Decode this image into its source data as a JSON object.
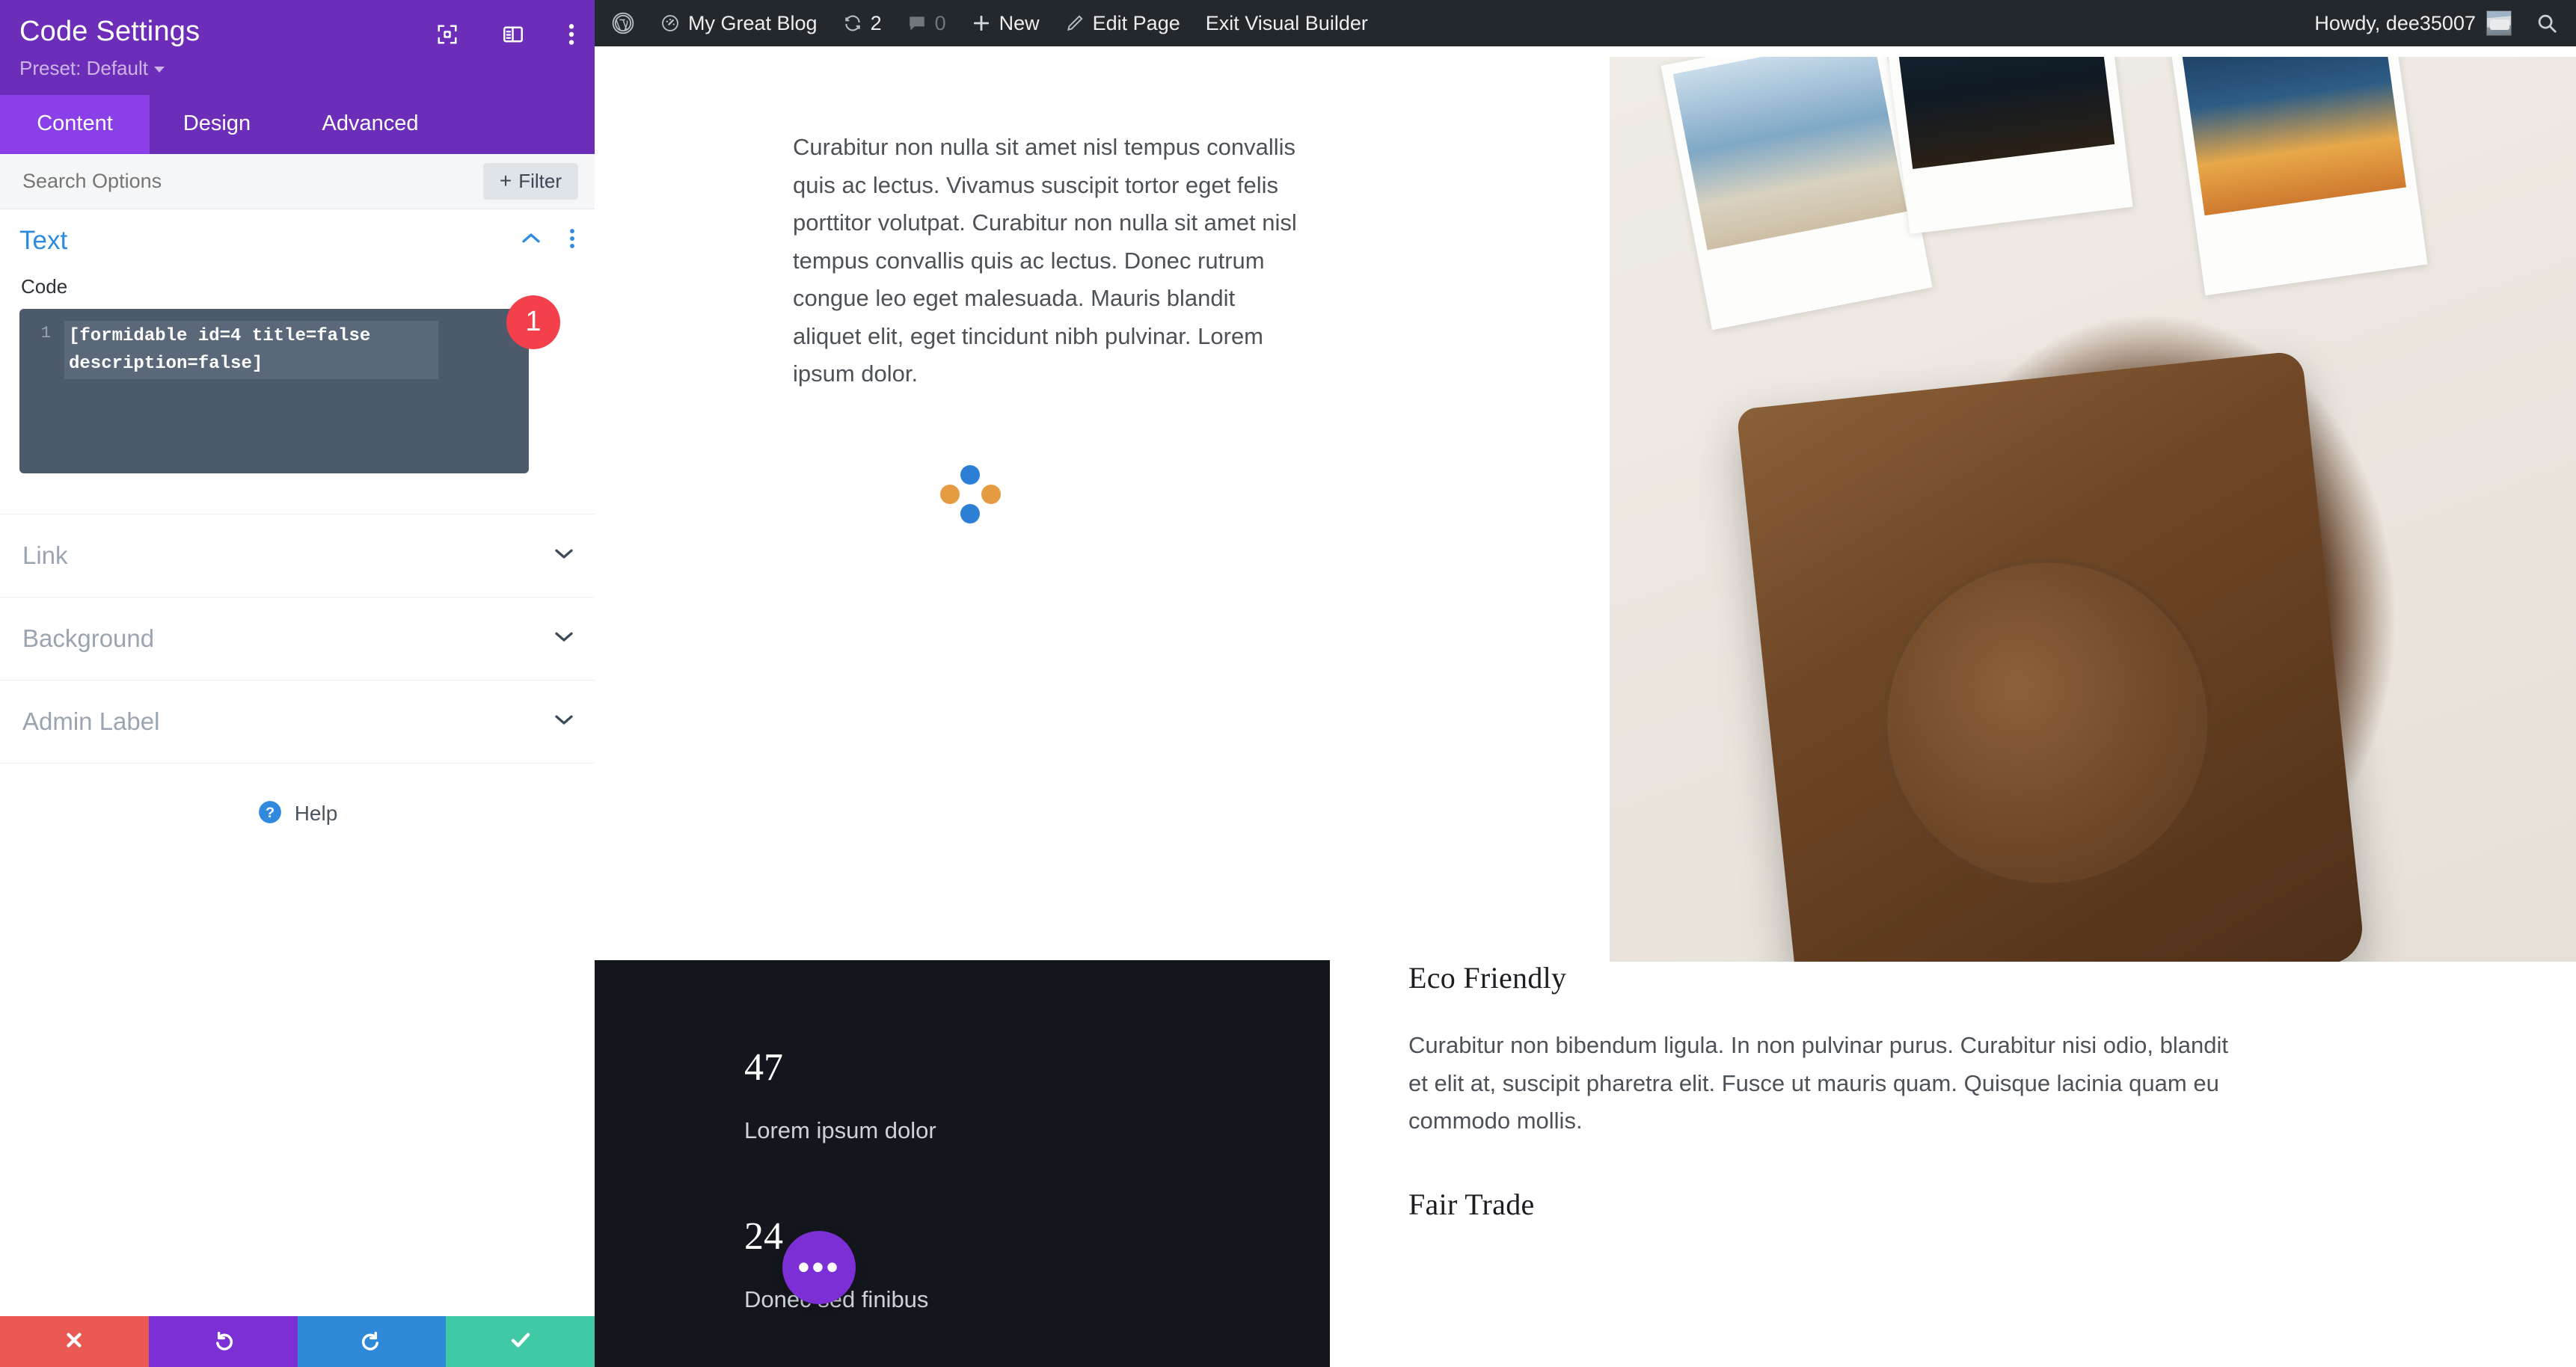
{
  "admin_bar": {
    "items": [
      {
        "icon": "wordpress-logo-icon",
        "label": ""
      },
      {
        "icon": "dashboard-icon",
        "label": "My Great Blog"
      },
      {
        "icon": "updates-icon",
        "label": "2"
      },
      {
        "icon": "comments-icon",
        "label": "0"
      },
      {
        "icon": "plus-icon",
        "label": "New"
      },
      {
        "icon": "pencil-icon",
        "label": "Edit Page"
      },
      {
        "icon": "",
        "label": "Exit Visual Builder"
      }
    ],
    "howdy": "Howdy, dee35007",
    "avatar_name": "user-avatar",
    "search_icon": "search-icon"
  },
  "panel": {
    "title": "Code Settings",
    "preset": "Preset: Default",
    "header_icons": [
      "focus-target-icon",
      "panel-layout-icon",
      "vertical-dots-icon"
    ],
    "tabs": [
      {
        "label": "Content",
        "active": true
      },
      {
        "label": "Design",
        "active": false
      },
      {
        "label": "Advanced",
        "active": false
      }
    ],
    "search_placeholder": "Search Options",
    "filter_button": "Filter",
    "section": {
      "title": "Text",
      "collapse_icon": "chevron-up-icon",
      "menu_icon": "vertical-dots-icon",
      "field_label": "Code",
      "code_line_number": "1",
      "code_value": "[formidable id=4 title=false description=false]",
      "badge": "1"
    },
    "collapsed_sections": [
      {
        "label": "Link",
        "icon": "chevron-down-icon"
      },
      {
        "label": "Background",
        "icon": "chevron-down-icon"
      },
      {
        "label": "Admin Label",
        "icon": "chevron-down-icon"
      }
    ],
    "help": {
      "label": "Help",
      "icon": "question-circle-icon"
    },
    "footer_buttons": [
      {
        "name": "cancel-button",
        "icon": "close-x-icon",
        "color": "#ea5a52"
      },
      {
        "name": "undo-button",
        "icon": "undo-arrow-icon",
        "color": "#7b2fd4"
      },
      {
        "name": "redo-button",
        "icon": "redo-arrow-icon",
        "color": "#2e8ad8"
      },
      {
        "name": "save-button",
        "icon": "checkmark-icon",
        "color": "#3fc9a4"
      }
    ]
  },
  "page": {
    "intro_paragraph": "Curabitur non nulla sit amet nisl tempus convallis quis ac lectus. Vivamus suscipit tortor eget felis porttitor volutpat. Curabitur non nulla sit amet nisl tempus convallis quis ac lectus. Donec rutrum congue leo eget malesuada. Mauris blandit aliquet elit, eget tincidunt nibh pulvinar. Lorem ipsum dolor.",
    "loading_spinner": "loading-spinner-icon",
    "hero_image_alt": "brown leather camera case on white surface with polaroid photos",
    "stats": [
      {
        "number": "47",
        "label": "Lorem ipsum dolor"
      },
      {
        "number": "24",
        "label": "Donec sed finibus"
      }
    ],
    "eco_heading": "Eco Friendly",
    "eco_paragraph": "Curabitur non bibendum ligula. In non pulvinar purus. Curabitur nisi odio, blandit et elit at, suscipit pharetra elit. Fusce ut mauris quam. Quisque lacinia quam eu commodo mollis.",
    "fair_heading": "Fair Trade",
    "fab_label": "•••"
  },
  "colors": {
    "panel_header_purple": "#6c2eb9",
    "active_tab_purple": "#8b3fe8",
    "section_title_blue": "#2e8ce0",
    "badge_red": "#f4404a",
    "admin_bar_dark": "#23282d",
    "stats_panel_dark": "#13161c",
    "fab_purple": "#7b2fd4"
  }
}
